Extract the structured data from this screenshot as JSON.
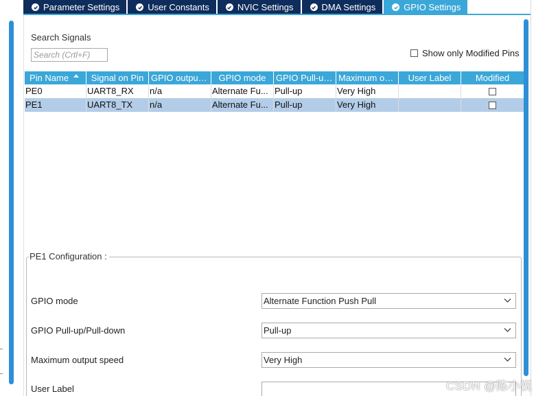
{
  "tabs": [
    {
      "label": "Parameter Settings",
      "active": false
    },
    {
      "label": "User Constants",
      "active": false
    },
    {
      "label": "NVIC Settings",
      "active": false
    },
    {
      "label": "DMA Settings",
      "active": false
    },
    {
      "label": "GPIO Settings",
      "active": true
    }
  ],
  "search": {
    "label": "Search Signals",
    "placeholder": "Search (Crtl+F)",
    "value": ""
  },
  "filter": {
    "show_only_modified_label": "Show only Modified Pins",
    "checked": false
  },
  "table": {
    "columns": [
      "Pin Name",
      "Signal on Pin",
      "GPIO output ...",
      "GPIO mode",
      "GPIO Pull-up...",
      "Maximum ou...",
      "User Label",
      "Modified"
    ],
    "rows": [
      {
        "pin": "PE0",
        "signal": "UART8_RX",
        "output": "n/a",
        "mode": "Alternate Fu...",
        "pull": "Pull-up",
        "speed": "Very High",
        "label": "",
        "modified": false,
        "selected": false
      },
      {
        "pin": "PE1",
        "signal": "UART8_TX",
        "output": "n/a",
        "mode": "Alternate Fu...",
        "pull": "Pull-up",
        "speed": "Very High",
        "label": "",
        "modified": false,
        "selected": true
      }
    ]
  },
  "config": {
    "title": "PE1 Configuration :",
    "gpio_mode_label": "GPIO mode",
    "gpio_mode_value": "Alternate Function Push Pull",
    "pull_label": "GPIO Pull-up/Pull-down",
    "pull_value": "Pull-up",
    "speed_label": "Maximum output speed",
    "speed_value": "Very High",
    "user_label_label": "User Label",
    "user_label_value": ""
  },
  "watermark": "CSDN @陈小悦",
  "colors": {
    "tab_inactive": "#0f2d5c",
    "tab_active": "#3ba7d8",
    "header": "#3ba7d8",
    "selected_row": "#b3cde8",
    "scrollbar": "#2f8fd6"
  },
  "icons": {
    "tab_status": "check-circle-icon",
    "sort": "sort-ascending-icon",
    "dropdown": "chevron-down-icon"
  }
}
